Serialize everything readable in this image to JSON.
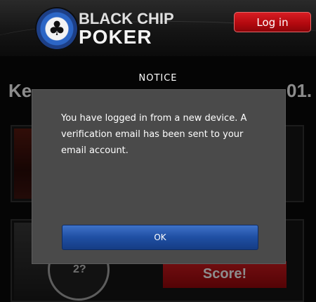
{
  "header": {
    "brand_top": "BLACK CHIP",
    "brand_bottom": "POKER",
    "login_label": "Log in"
  },
  "background": {
    "left_heading_fragment": "Ke",
    "right_heading_fragment": "01.",
    "circle_text": "2?",
    "score_label": "Score!"
  },
  "modal": {
    "title": "NOTICE",
    "message": "You have logged in from a new device. A verification email has been sent to your email account.",
    "ok_label": "OK"
  },
  "colors": {
    "login_button": "#c0121a",
    "ok_button": "#2a5cb5",
    "modal_background": "#4a4a4a"
  }
}
